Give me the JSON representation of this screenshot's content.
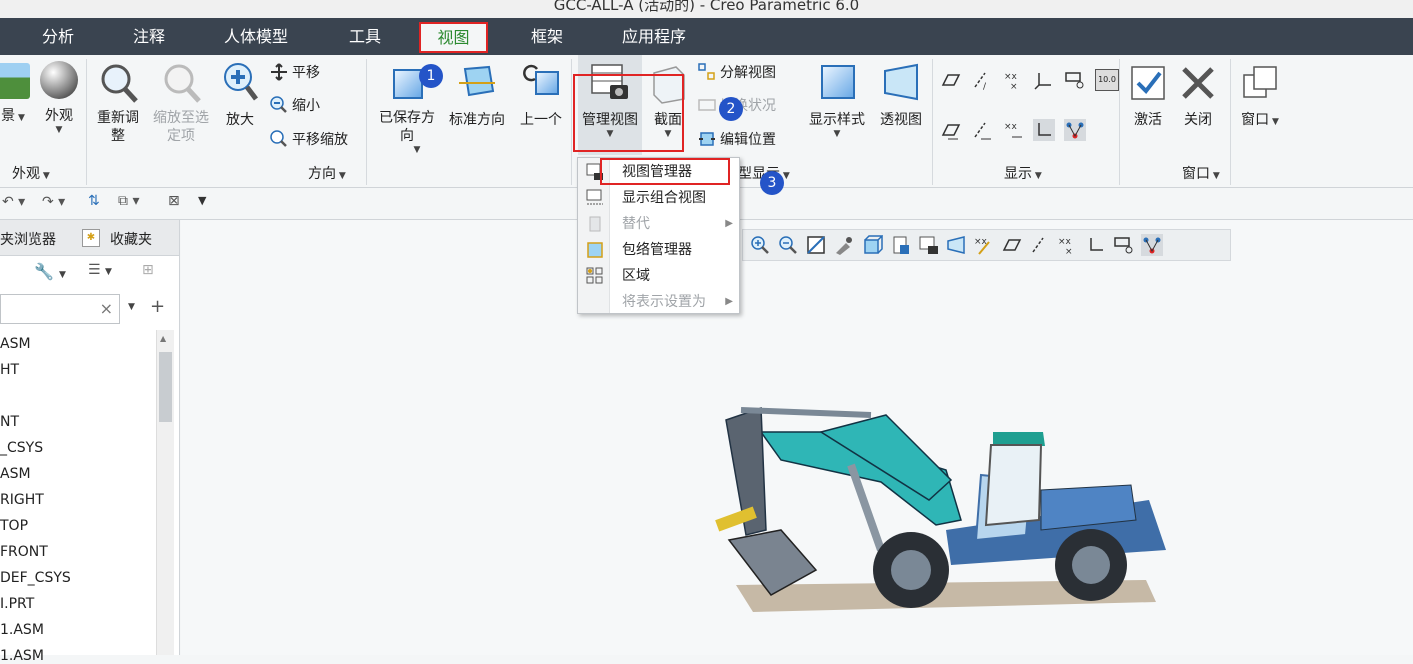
{
  "window": {
    "title": "GCC-ALL-A (活动的) - Creo Parametric 6.0"
  },
  "tabs": [
    "分析",
    "注释",
    "人体模型",
    "工具",
    "视图",
    "框架",
    "应用程序"
  ],
  "active_tab": "视图",
  "ribbon": {
    "appearance": {
      "scene_label": "景",
      "appearance_label": "外观",
      "group_label": "外观"
    },
    "orientation": {
      "refit": "重新调整",
      "zoom_selected": "缩放至选定项",
      "zoom_in": "放大",
      "pan": "平移",
      "zoom_out": "缩小",
      "pan_zoom": "平移缩放",
      "saved_orientations": "已保存方向",
      "standard_orientation": "标准方向",
      "previous": "上一个",
      "group_label": "方向"
    },
    "model_display": {
      "manage_views": "管理视图",
      "section": "截面",
      "explode_view": "分解视图",
      "toggle_status": "切换状况",
      "edit_position": "编辑位置",
      "display_style": "显示样式",
      "perspective": "透视图",
      "group_label_partial": "型显示"
    },
    "show": {
      "group_label": "显示",
      "annotation_size": "10.0"
    },
    "window": {
      "activate": "激活",
      "close": "关闭",
      "windows": "窗口",
      "group_label": "窗口"
    }
  },
  "dropdown_menu": {
    "items": [
      {
        "label": "视图管理器",
        "enabled": true
      },
      {
        "label": "显示组合视图",
        "enabled": true
      },
      {
        "label": "替代",
        "enabled": false,
        "submenu": true
      },
      {
        "label": "包络管理器",
        "enabled": true
      },
      {
        "label": "区域",
        "enabled": true
      },
      {
        "label": "将表示设置为",
        "enabled": false,
        "submenu": true
      }
    ]
  },
  "badges": [
    "1",
    "2",
    "3"
  ],
  "panel": {
    "tabs": [
      "夹浏览器",
      "收藏夹"
    ],
    "tree_items": [
      "ASM",
      "HT",
      "",
      "NT",
      "_CSYS",
      "ASM",
      "RIGHT",
      "TOP",
      "FRONT",
      "DEF_CSYS",
      "I.PRT",
      "1.ASM",
      "1.ASM"
    ]
  },
  "colors": {
    "tab_bar": "#3a4450",
    "highlight": "#e02424",
    "badge": "#2454c8",
    "active_tab_text": "#2c8a30"
  }
}
